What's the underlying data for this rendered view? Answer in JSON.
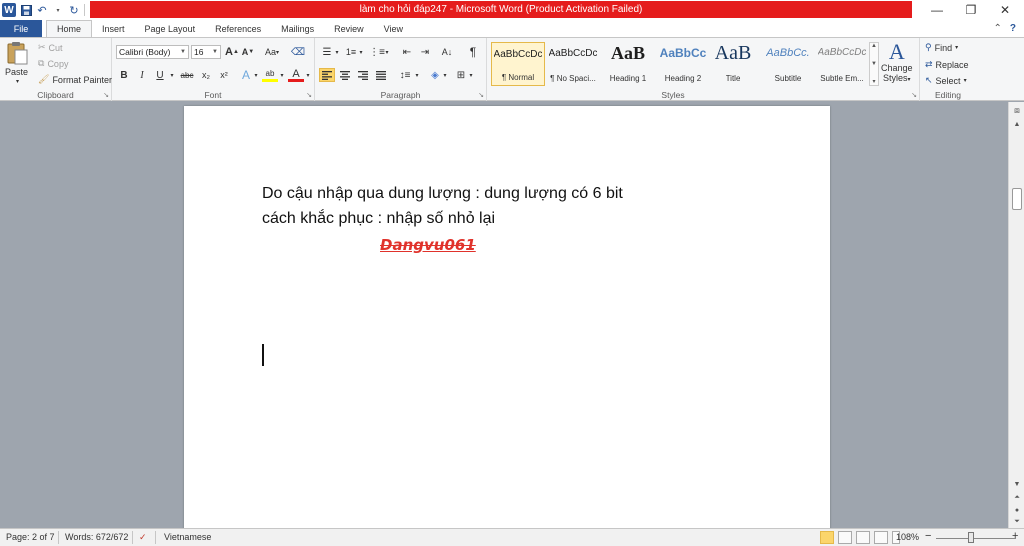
{
  "window": {
    "title": "làm cho hỏi đáp247  -  Microsoft Word (Product Activation Failed)",
    "controls": {
      "minimize": "—",
      "restore": "❐",
      "close": "✕"
    }
  },
  "tabs": {
    "file": "File",
    "items": [
      "Home",
      "Insert",
      "Page Layout",
      "References",
      "Mailings",
      "Review",
      "View"
    ],
    "active": "Home"
  },
  "clipboard": {
    "paste": "Paste",
    "cut": "Cut",
    "copy": "Copy",
    "format_painter": "Format Painter",
    "label": "Clipboard"
  },
  "font": {
    "name": "Calibri (Body)",
    "size": "16",
    "grow": "A",
    "shrink": "A",
    "case": "Aa",
    "bold": "B",
    "italic": "I",
    "underline": "U",
    "strike": "abc",
    "subscript": "x₂",
    "superscript": "x²",
    "effects": "A",
    "highlight": "ab",
    "color": "A",
    "label": "Font"
  },
  "paragraph": {
    "label": "Paragraph",
    "show_marks": "¶"
  },
  "styles": {
    "items": [
      {
        "preview": "AaBbCcDc",
        "name": "¶ Normal"
      },
      {
        "preview": "AaBbCcDc",
        "name": "¶ No Spaci..."
      },
      {
        "preview": "AaB",
        "name": "Heading 1"
      },
      {
        "preview": "AaBbCc",
        "name": "Heading 2"
      },
      {
        "preview": "AaB",
        "name": "Title"
      },
      {
        "preview": "AaBbCc.",
        "name": "Subtitle"
      },
      {
        "preview": "AaBbCcDc",
        "name": "Subtle Em..."
      }
    ],
    "change_styles_line1": "Change",
    "change_styles_line2": "Styles",
    "label": "Styles"
  },
  "editing": {
    "find": "Find",
    "replace": "Replace",
    "select": "Select",
    "label": "Editing"
  },
  "document": {
    "line1": "Do cậu nhập qua dung lượng : dung lượng có 6 bit",
    "line2": "cách khắc phục : nhập số nhỏ lại",
    "signature": "Dangvu061"
  },
  "status": {
    "page": "Page: 2 of 7",
    "words": "Words: 672/672",
    "language": "Vietnamese",
    "zoom": "108%",
    "zoom_out": "−",
    "zoom_in": "+"
  },
  "colors": {
    "accent": "#2b579a",
    "title_bar_red": "#e51c1c",
    "signature_red": "#e0322b",
    "selected_yellow": "#fbd56b"
  }
}
